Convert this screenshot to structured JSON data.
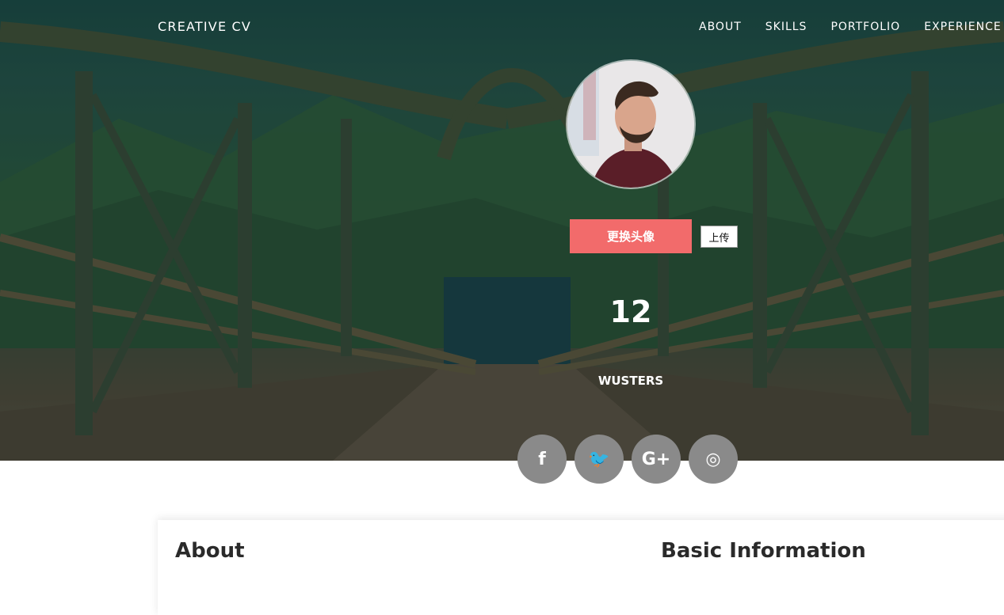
{
  "brand": "CREATIVE CV",
  "nav": [
    "ABOUT",
    "SKILLS",
    "PORTFOLIO",
    "EXPERIENCE"
  ],
  "profile": {
    "change_avatar_label": "更换头像",
    "upload_label": "上传",
    "count": "12",
    "count_label": "WUSTERS"
  },
  "social": [
    {
      "icon": "facebook-icon",
      "glyph": "f"
    },
    {
      "icon": "twitter-icon",
      "glyph": "🐦"
    },
    {
      "icon": "google-plus-icon",
      "glyph": "G+"
    },
    {
      "icon": "instagram-icon",
      "glyph": "◎"
    }
  ],
  "sections": {
    "about_title": "About",
    "basic_title": "Basic Information"
  },
  "colors": {
    "accent": "#f26b6b",
    "social_bg": "#8a8a8a"
  }
}
